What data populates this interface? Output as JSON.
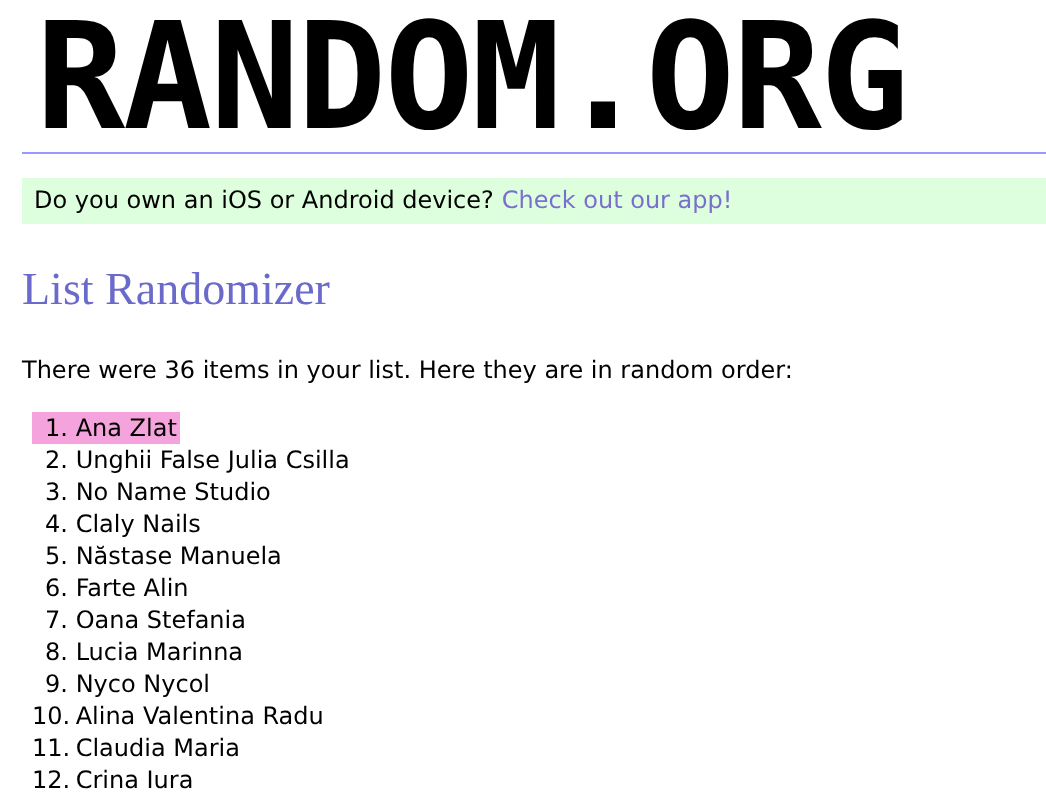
{
  "logo": {
    "text": "RANDOM.ORG"
  },
  "banner": {
    "text": "Do you own an iOS or Android device?",
    "link": "Check out our app!"
  },
  "heading": "List Randomizer",
  "intro": "There were 36 items in your list. Here they are in random order:",
  "items": [
    {
      "number": "1.",
      "name": "Ana Zlat",
      "highlighted": true
    },
    {
      "number": "2.",
      "name": "Unghii False Julia Csilla",
      "highlighted": false
    },
    {
      "number": "3.",
      "name": "No Name Studio",
      "highlighted": false
    },
    {
      "number": "4.",
      "name": "Claly Nails",
      "highlighted": false
    },
    {
      "number": "5.",
      "name": "Năstase Manuela",
      "highlighted": false
    },
    {
      "number": "6.",
      "name": "Farte Alin",
      "highlighted": false
    },
    {
      "number": "7.",
      "name": "Oana Stefania",
      "highlighted": false
    },
    {
      "number": "8.",
      "name": "Lucia Marinna",
      "highlighted": false
    },
    {
      "number": "9.",
      "name": "Nyco Nycol",
      "highlighted": false
    },
    {
      "number": "10.",
      "name": "Alina Valentina Radu",
      "highlighted": false
    },
    {
      "number": "11.",
      "name": "Claudia Maria",
      "highlighted": false
    },
    {
      "number": "12.",
      "name": "Crina Iura",
      "highlighted": false
    }
  ]
}
